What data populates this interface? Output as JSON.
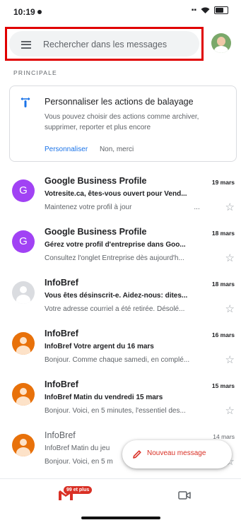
{
  "status_bar": {
    "time": "10:19"
  },
  "search": {
    "placeholder": "Rechercher dans les messages"
  },
  "section": {
    "label": "PRINCIPALE"
  },
  "swipe_card": {
    "title": "Personnaliser les actions de balayage",
    "description": "Vous pouvez choisir des actions comme archiver, supprimer, reporter et plus encore",
    "primary_action": "Personnaliser",
    "secondary_action": "Non, merci"
  },
  "emails": [
    {
      "sender": "Google Business Profile",
      "date": "19 mars",
      "subject": "Votresite.ca, êtes-vous ouvert pour Vend...",
      "preview": "Maintenez votre profil à jour",
      "preview_suffix": "...",
      "avatar_letter": "G",
      "avatar_color": "#a142f4"
    },
    {
      "sender": "Google Business Profile",
      "date": "18 mars",
      "subject": "Gérez votre profil d'entreprise dans Goo...",
      "preview": "Consultez l'onglet Entreprise dès aujourd'h...",
      "avatar_letter": "G",
      "avatar_color": "#a142f4"
    },
    {
      "sender": "InfoBref",
      "date": "18 mars",
      "subject": "Vous êtes désinscrit-e. Aidez-nous: dites...",
      "preview": "Votre adresse courriel a été retirée. Désolé...",
      "avatar_color": "#dadce0"
    },
    {
      "sender": "InfoBref",
      "date": "16 mars",
      "subject": "InfoBref Votre argent du 16 mars",
      "preview": "Bonjour. Comme chaque samedi, en complé...",
      "avatar_color": "#e8710a"
    },
    {
      "sender": "InfoBref",
      "date": "15 mars",
      "subject": "InfoBref Matin du vendredi 15 mars",
      "preview": "Bonjour. Voici, en 5 minutes, l'essentiel des...",
      "avatar_color": "#e8710a"
    },
    {
      "sender": "InfoBref",
      "date": "14 mars",
      "subject": "InfoBref Matin du jeu",
      "preview": "Bonjour. Voici, en 5 m",
      "avatar_color": "#e8710a",
      "read": true
    }
  ],
  "compose": {
    "label": "Nouveau message"
  },
  "bottom_nav": {
    "mail_badge": "99 et plus"
  },
  "colors": {
    "accent_red": "#d93025",
    "link_blue": "#1a73e8",
    "highlight_box": "#e00000"
  }
}
